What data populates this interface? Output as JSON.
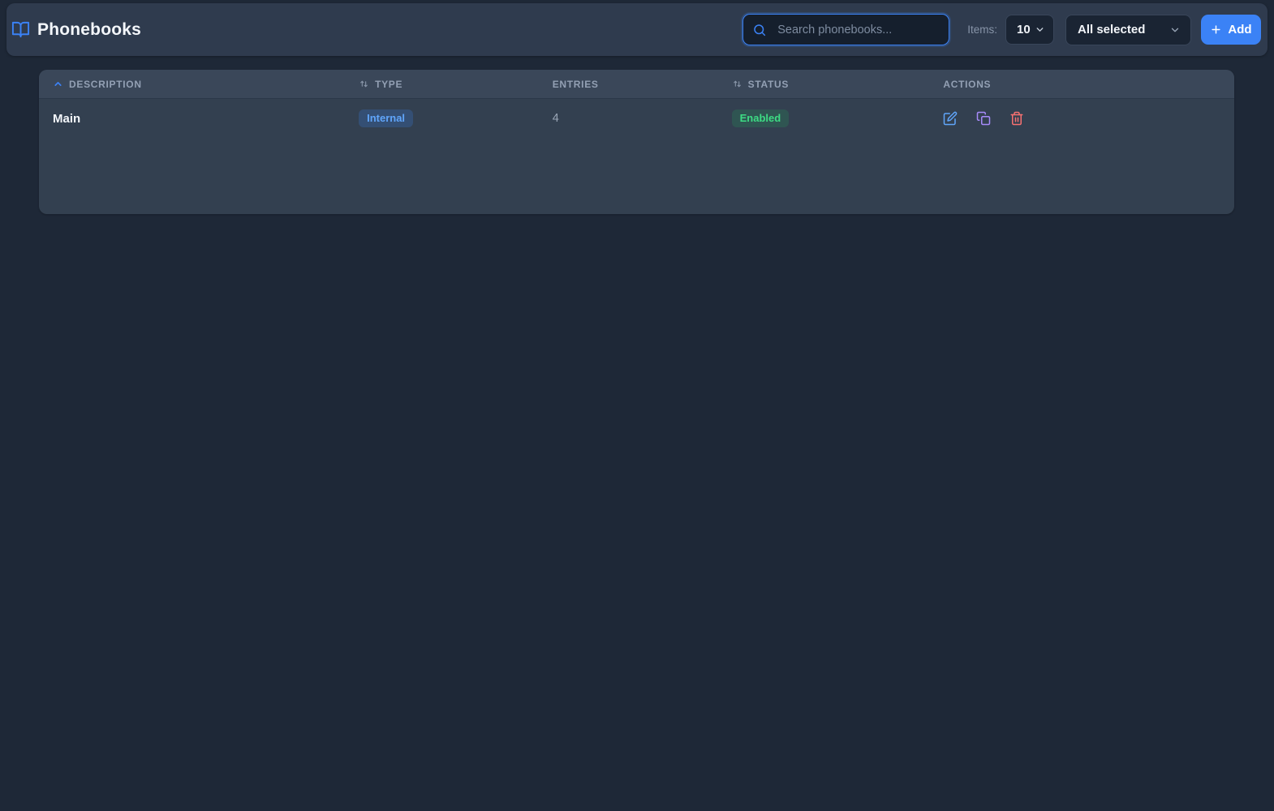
{
  "header": {
    "title": "Phonebooks",
    "search_placeholder": "Search phonebooks...",
    "search_value": "",
    "items_label": "Items:",
    "items_value": "10",
    "filter_value": "All selected",
    "add_label": "Add"
  },
  "table": {
    "columns": [
      {
        "label": "DESCRIPTION",
        "sortable": true,
        "sorted": "asc"
      },
      {
        "label": "TYPE",
        "sortable": true,
        "sorted": "none"
      },
      {
        "label": "ENTRIES",
        "sortable": false,
        "sorted": "none"
      },
      {
        "label": "STATUS",
        "sortable": true,
        "sorted": "none"
      },
      {
        "label": "ACTIONS",
        "sortable": false,
        "sorted": "none"
      }
    ],
    "rows": [
      {
        "description": "Main",
        "type": "Internal",
        "entries": "4",
        "status": "Enabled"
      }
    ]
  },
  "icons": {
    "logo": "book-open-icon",
    "search": "search-icon",
    "sort_asc": "chevron-up-icon",
    "sort_both": "arrows-up-down-icon",
    "select_caret": "chevron-down-icon",
    "add": "plus-icon",
    "edit": "pencil-square-icon",
    "copy": "copy-icon",
    "delete": "trash-icon"
  },
  "colors": {
    "page_bg": "#1e2837",
    "header_bg": "#2f3b4e",
    "card_bg": "#334050",
    "accent_blue": "#3b82f6",
    "type_badge_text": "#60a5fa",
    "status_badge_text": "#3ddc84",
    "edit_icon": "#60a5fa",
    "copy_icon": "#a78bfa",
    "delete_icon": "#f87171"
  }
}
